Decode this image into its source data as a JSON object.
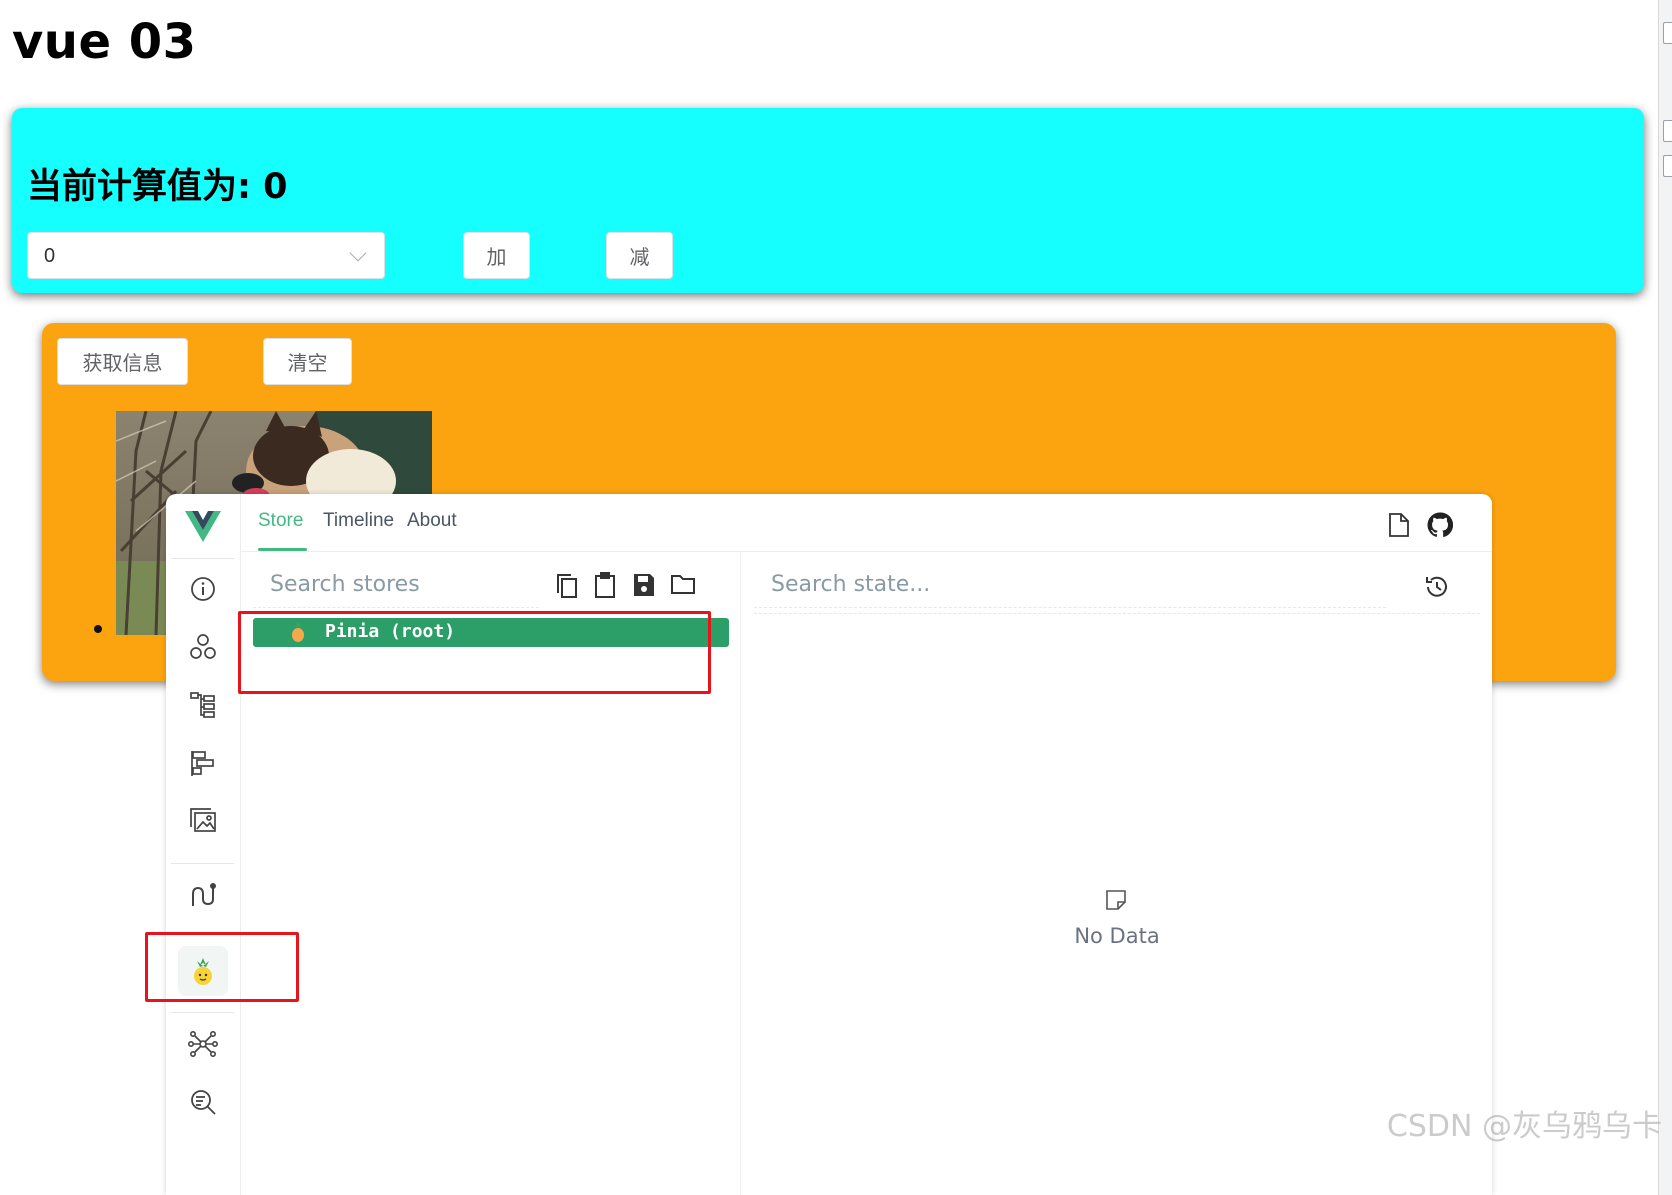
{
  "page": {
    "title": "vue 03"
  },
  "counter": {
    "title": "当前计算值为: 0",
    "select_value": "0",
    "add_label": "加",
    "subtract_label": "减",
    "panel_color": "#16ffff"
  },
  "info": {
    "get_info_label": "获取信息",
    "clear_label": "清空",
    "panel_color": "#fca410",
    "photo_icon": "dog-photo"
  },
  "devtools": {
    "tabs": [
      {
        "label": "Store",
        "active": true
      },
      {
        "label": "Timeline",
        "active": false
      },
      {
        "label": "About",
        "active": false
      }
    ],
    "accent_color": "#42b883",
    "sidebar_icons": [
      "vue-logo-icon",
      "info-icon",
      "components-icon",
      "component-tree-icon",
      "timeline-icon",
      "assets-icon",
      "routes-icon",
      "pinia-icon",
      "graph-icon",
      "inspect-icon"
    ],
    "header_icons": [
      "document-icon",
      "github-icon"
    ],
    "store_pane": {
      "search_placeholder": "Search stores",
      "toolbar_icons": [
        "copy-icon",
        "clipboard-icon",
        "save-icon",
        "folder-icon"
      ],
      "stores": [
        {
          "label": "Pinia (root)",
          "icon": "pinia-icon",
          "selected": true
        }
      ]
    },
    "state_pane": {
      "search_placeholder": "Search state...",
      "history_icon": "history-icon",
      "empty_label": "No Data"
    }
  },
  "watermark": "CSDN @灰乌鸦乌卡"
}
